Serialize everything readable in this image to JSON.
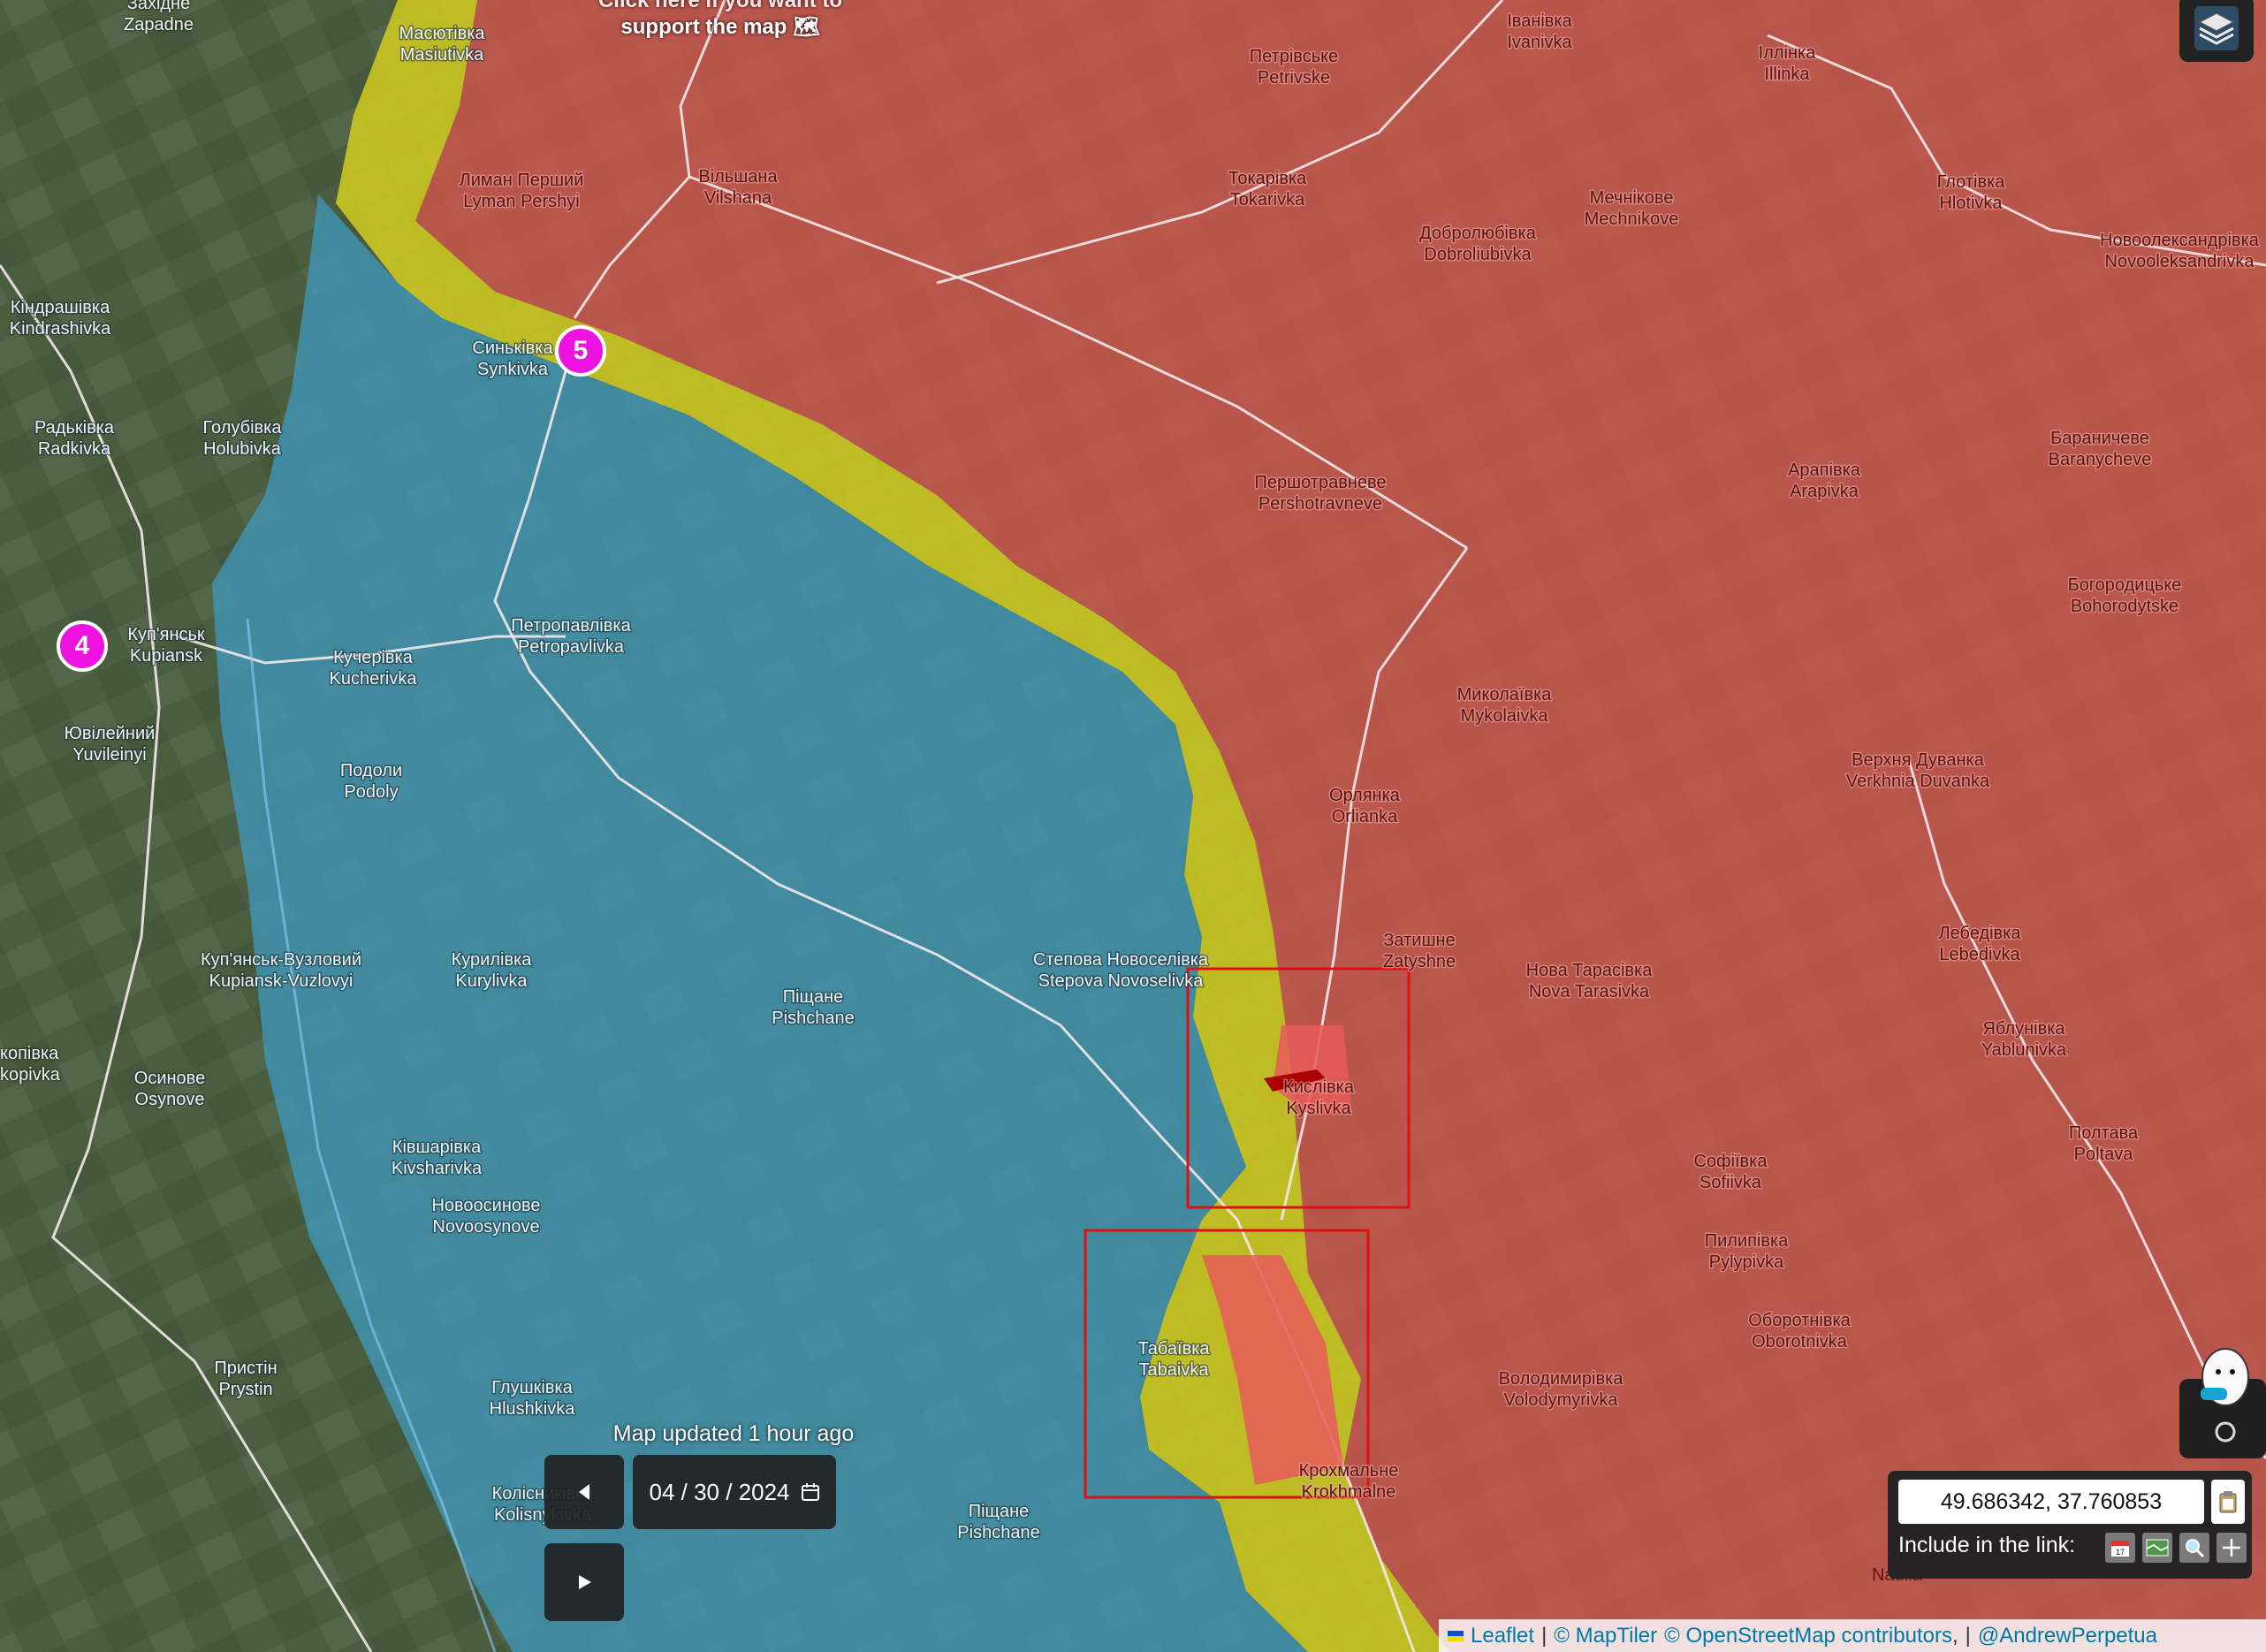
{
  "banner": {
    "line1": "Click here if you want to",
    "line2": "support the map 🗺"
  },
  "markers": [
    {
      "label": "4"
    },
    {
      "label": "5"
    }
  ],
  "places": [
    {
      "ua": "Масютівка",
      "en": "Masiutivka"
    },
    {
      "ua": "Лиман Перший",
      "en": "Lyman Pershyi"
    },
    {
      "ua": "Вільшана",
      "en": "Vilshana"
    },
    {
      "ua": "Петрівське",
      "en": "Petrivske"
    },
    {
      "ua": "Іванівка",
      "en": "Ivanivka"
    },
    {
      "ua": "Іллінка",
      "en": "Illinka"
    },
    {
      "ua": "Токарівка",
      "en": "Tokarivka"
    },
    {
      "ua": "Мечнікове",
      "en": "Mechnikove"
    },
    {
      "ua": "Глотівка",
      "en": "Hlotivka"
    },
    {
      "ua": "Добролюбівка",
      "en": "Dobroliubivka"
    },
    {
      "ua": "Новоолександрівка",
      "en": "Novooleksandrivka"
    },
    {
      "ua": "Кіндрашівка",
      "en": "Kindrashivka"
    },
    {
      "ua": "Синьківка",
      "en": "Synkivka"
    },
    {
      "ua": "Радьківка",
      "en": "Radkivka"
    },
    {
      "ua": "Голубівка",
      "en": "Holubivka"
    },
    {
      "ua": "Першотравневе",
      "en": "Pershotravneve"
    },
    {
      "ua": "Арапівка",
      "en": "Arapivka"
    },
    {
      "ua": "Бараничеве",
      "en": "Baranycheve"
    },
    {
      "ua": "Куп'янськ",
      "en": "Kupiansk"
    },
    {
      "ua": "Кучерівка",
      "en": "Kucherivka"
    },
    {
      "ua": "Петропавлівка",
      "en": "Petropavlivka"
    },
    {
      "ua": "Богородицьке",
      "en": "Bohorodytske"
    },
    {
      "ua": "Ювілейний",
      "en": "Yuvileinyi"
    },
    {
      "ua": "Подоли",
      "en": "Podoly"
    },
    {
      "ua": "Миколаївка",
      "en": "Mykolaivka"
    },
    {
      "ua": "Верхня Дуванка",
      "en": "Verkhnia Duvanka"
    },
    {
      "ua": "Орлянка",
      "en": "Orlianka"
    },
    {
      "ua": "Куп'янськ-Вузловий",
      "en": "Kupiansk-Vuzlovyi"
    },
    {
      "ua": "Курилівка",
      "en": "Kurylivka"
    },
    {
      "ua": "Степова Новоселівка",
      "en": "Stepova Novoselivka"
    },
    {
      "ua": "Затишне",
      "en": "Zatyshne"
    },
    {
      "ua": "Нова Тарасівка",
      "en": "Nova Tarasivka"
    },
    {
      "ua": "Лебедівка",
      "en": "Lebedivka"
    },
    {
      "ua": "Піщане",
      "en": "Pishchane"
    },
    {
      "ua": "Осинове",
      "en": "Osynove"
    },
    {
      "ua": "Кислівка",
      "en": "Kyslivka"
    },
    {
      "ua": "Яблунівка",
      "en": "Yablunivka"
    },
    {
      "ua": "Полтава",
      "en": "Poltava"
    },
    {
      "ua": "Ківшарівка",
      "en": "Kivsharivka"
    },
    {
      "ua": "Новоосинове",
      "en": "Novoosynove"
    },
    {
      "ua": "Софіївка",
      "en": "Sofiivka"
    },
    {
      "ua": "Пилипівка",
      "en": "Pylypivka"
    },
    {
      "ua": "Оборотнівка",
      "en": "Oborotnivka"
    },
    {
      "ua": "Пристін",
      "en": "Prystin"
    },
    {
      "ua": "Табаївка",
      "en": "Tabaivka"
    },
    {
      "ua": "Володимирівка",
      "en": "Volodymyrivka"
    },
    {
      "ua": "Глушківка",
      "en": "Hlushkivka"
    },
    {
      "ua": "Крохмальне",
      "en": "Krokhmalne"
    },
    {
      "ua": "Колісниківка",
      "en": "Kolisnykivka"
    },
    {
      "ua": "Піщане",
      "en": "Pishchane"
    }
  ],
  "edge_labels": {
    "topleft_a": "Західне",
    "topleft_b": "Zapadne",
    "left_a": "копівка",
    "left_b": "kopivka",
    "bottomright_a": "Н",
    "bottomright_b": "Nadiia"
  },
  "date_control": {
    "status": "Map updated 1 hour ago",
    "date": "04 / 30 / 2024",
    "prev_icon": "triangle-left-icon",
    "play_icon": "play-icon",
    "calendar_icon": "calendar-icon"
  },
  "coords": {
    "value": "49.686342, 37.760853",
    "include_label": "Include in the link:",
    "copy_icon": "clipboard-icon",
    "options": [
      "calendar-icon",
      "map-icon",
      "zoom-icon",
      "crosshair-icon"
    ]
  },
  "attribution": {
    "leaflet": "Leaflet",
    "sep1": "|",
    "maptiler": "© MapTiler",
    "osm": "© OpenStreetMap contributors",
    "sep2": ",",
    "sep3": "|",
    "author": "@AndrewPerpetua"
  },
  "colors": {
    "occupied": "#d9554f",
    "ukraine": "#3f9bc4",
    "contested": "#d8d11e",
    "marker": "#ee12e0",
    "highlight_box": "#e01010"
  }
}
